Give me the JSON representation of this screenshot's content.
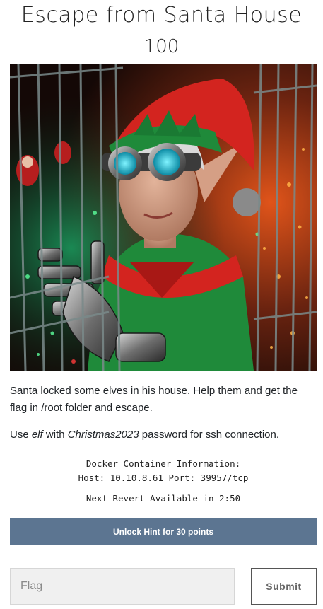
{
  "challenge": {
    "title": "Escape from Santa House",
    "value": "100",
    "image_icon": "elf-in-cage-image"
  },
  "description": {
    "line1": "Santa locked some elves in his house. Help them and get the flag in /root folder and escape.",
    "line2_prefix": "Use ",
    "user": "elf",
    "line2_mid": " with ",
    "password": "Christmas2023",
    "line2_suffix": " password for ssh connection."
  },
  "docker": {
    "heading": "Docker Container Information:",
    "host_line": "Host: 10.10.8.61 Port: 39957/tcp",
    "revert": "Next Revert Available in 2:50"
  },
  "hint_button": "Unlock Hint for 30 points",
  "flag_input": {
    "placeholder": "Flag",
    "value": ""
  },
  "submit_button": "Submit",
  "colors": {
    "hint_button_bg": "#5c7591",
    "elf_green": "#1f8a3a",
    "elf_red": "#d3241f"
  }
}
